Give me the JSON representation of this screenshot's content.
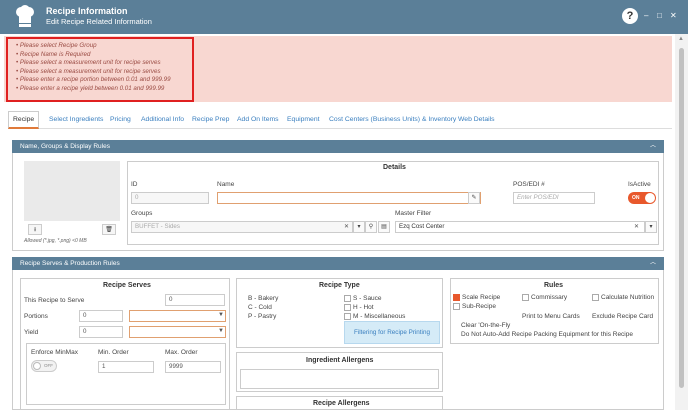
{
  "window": {
    "title": "Recipe Information",
    "subtitle": "Edit Recipe Related Information",
    "help": "?",
    "minimize": "–",
    "restore": "□",
    "close": "✕"
  },
  "errors": [
    "Please select Recipe Group",
    "Recipe Name is Required",
    "Please select a measurement unit for recipe serves",
    "Please select a measurement unit for recipe serves",
    "Please enter a recipe portion between 0.01 and 999.99",
    "Please enter a recipe yield between 0.01 and 999.99"
  ],
  "tabs": [
    "Recipe",
    "Select Ingredients",
    "Pricing",
    "Additional Info",
    "Recipe Prep",
    "Add On Items",
    "Equipment",
    "Cost Centers (Business Units) & Inventory",
    "Web Details"
  ],
  "section1": {
    "title": "Name, Groups & Display Rules",
    "allowed": "Allowed (*.jpg, *.png) <0 MB",
    "details": {
      "title": "Details",
      "id_label": "ID",
      "id_value": "0",
      "name_label": "Name",
      "name_value": "",
      "pos_label": "POS/EDI #",
      "pos_placeholder": "Enter POS/EDI",
      "active_label": "IsActive",
      "active_state": "ON",
      "groups_label": "Groups",
      "groups_value": "BUFFET - Sides",
      "master_label": "Master Filter",
      "master_value": "Ezq Cost Center"
    }
  },
  "section2": {
    "title": "Recipe Serves & Production Rules",
    "serves": {
      "title": "Recipe Serves",
      "serve_label": "This Recipe to Serve",
      "serve_value": "0",
      "portions_label": "Portions",
      "portions_value": "0",
      "yield_label": "Yield",
      "yield_value": "0",
      "enforce_label": "Enforce MinMax",
      "enforce_state": "OFF",
      "min_label": "Min. Order",
      "min_value": "1",
      "max_label": "Max. Order",
      "max_value": "9999"
    },
    "type": {
      "title": "Recipe Type",
      "left": [
        "B - Bakery",
        "C - Cold",
        "P - Pastry"
      ],
      "right": [
        "S - Sauce",
        "H - Hot",
        "M - Miscellaneous"
      ],
      "filter_button": "Filtering for Recipe Printing"
    },
    "allergens_ingredient": "Ingredient Allergens",
    "allergens_recipe": "Recipe Allergens",
    "rules": {
      "title": "Rules",
      "scale": "Scale Recipe",
      "commissary": "Commissary",
      "calc_nutrition": "Calculate Nutrition",
      "sub_recipe": "Sub-Recipe",
      "print_menu": "Print to Menu Cards",
      "exclude_card": "Exclude Recipe Card",
      "clear_fly": "Clear 'On-the-Fly",
      "no_auto_add": "Do Not Auto-Add Recipe Packing Equipment for this Recipe"
    }
  },
  "colors": {
    "header": "#5b7f98",
    "error_bg": "#f8d7d1",
    "error_border": "#e02020",
    "accent": "#e8582c",
    "link": "#3a7fbf"
  }
}
